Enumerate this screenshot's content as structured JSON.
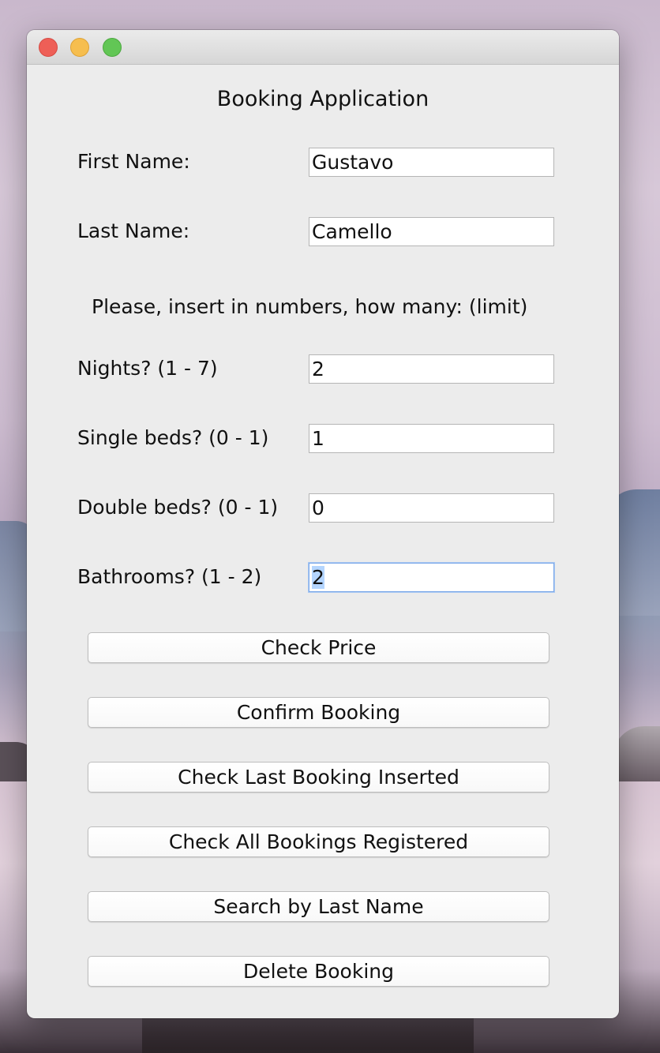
{
  "app": {
    "title": "Booking Application"
  },
  "form": {
    "first_name_label": "First Name:",
    "first_name_value": "Gustavo",
    "last_name_label": "Last Name:",
    "last_name_value": "Camello",
    "instructions": "Please, insert in numbers, how many: (limit)",
    "nights_label": "Nights? (1 - 7)",
    "nights_value": "2",
    "single_beds_label": "Single beds? (0 - 1)",
    "single_beds_value": "1",
    "double_beds_label": "Double beds? (0 - 1)",
    "double_beds_value": "0",
    "bathrooms_label": "Bathrooms? (1 - 2)",
    "bathrooms_value": "2"
  },
  "buttons": {
    "check_price": "Check Price",
    "confirm_booking": "Confirm Booking",
    "check_last_booking": "Check Last Booking Inserted",
    "check_all_bookings": "Check All Bookings Registered",
    "search_by_last_name": "Search by Last Name",
    "delete_booking": "Delete Booking"
  },
  "colors": {
    "window_bg": "#ececec",
    "close": "#ee5f57",
    "minimize": "#f6be4f",
    "zoom": "#62c655",
    "focus_ring": "#7aa7e8",
    "selection": "#b4d5fe"
  }
}
